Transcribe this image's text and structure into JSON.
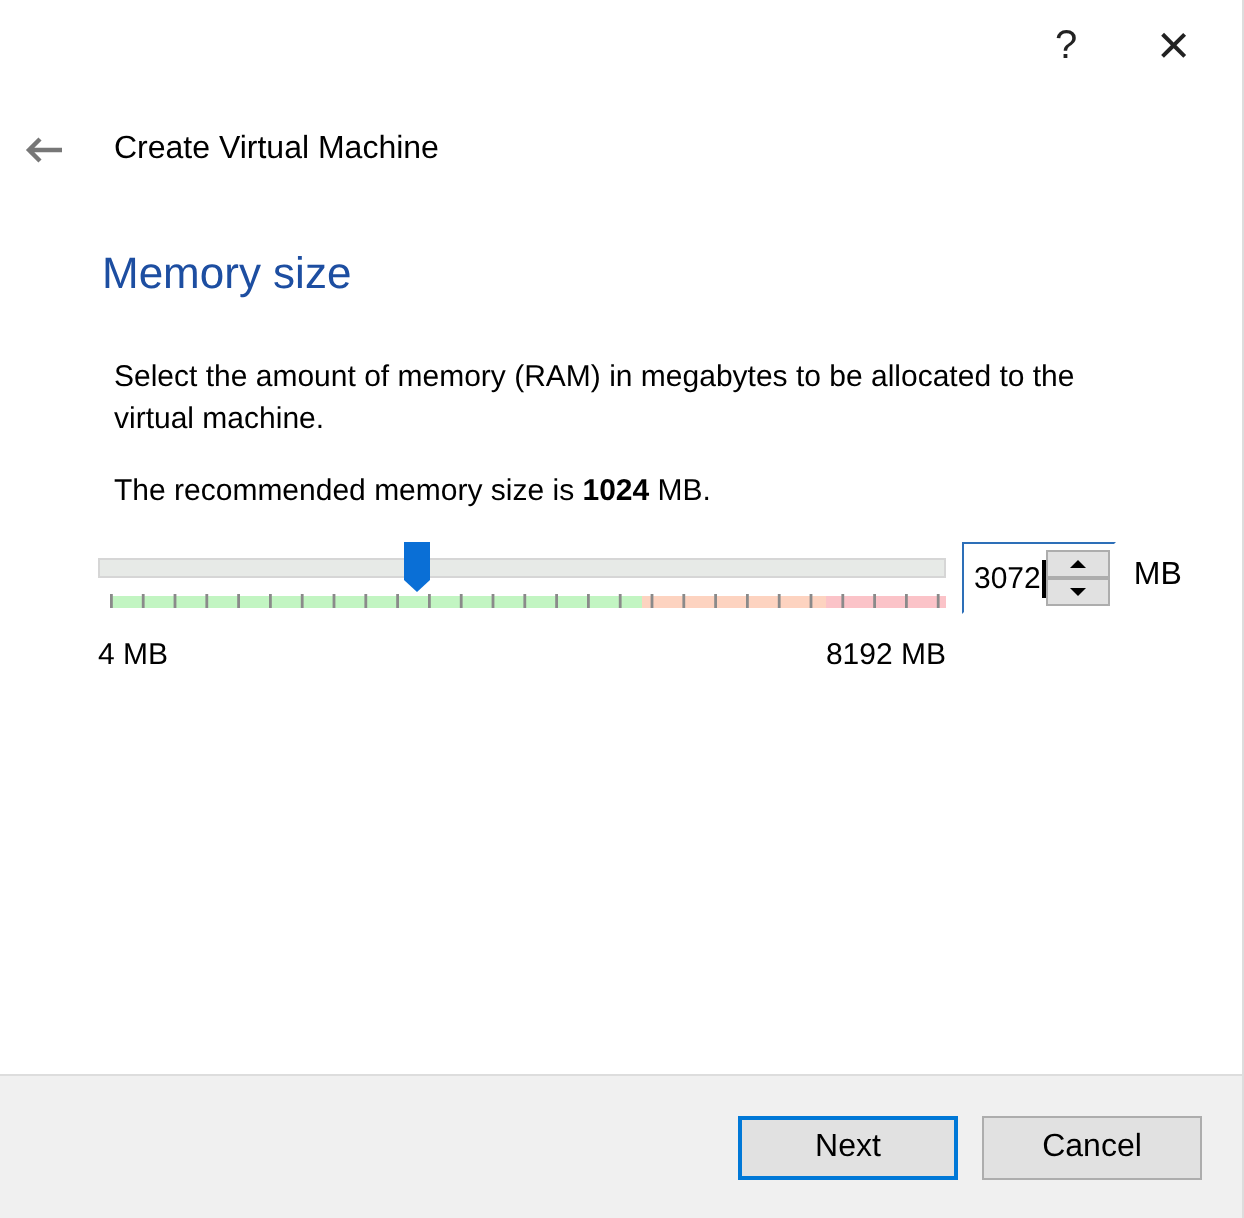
{
  "title_bar": {
    "help": "?",
    "close": "×"
  },
  "wizard_title": "Create Virtual Machine",
  "page_heading": "Memory size",
  "description": "Select the amount of memory (RAM) in megabytes to be allocated to the virtual machine.",
  "recommendation": "The recommended memory size is **1024** MB.",
  "memory_slider": {
    "level": 0.375,
    "min_label": "4 MB",
    "max_label": "8192 MB"
  },
  "memory_field": {
    "value": "3072",
    "unit": "MB"
  },
  "buttons": [
    {
      "label": "Next",
      "default": true
    },
    {
      "label": "Cancel",
      "default": false
    }
  ]
}
